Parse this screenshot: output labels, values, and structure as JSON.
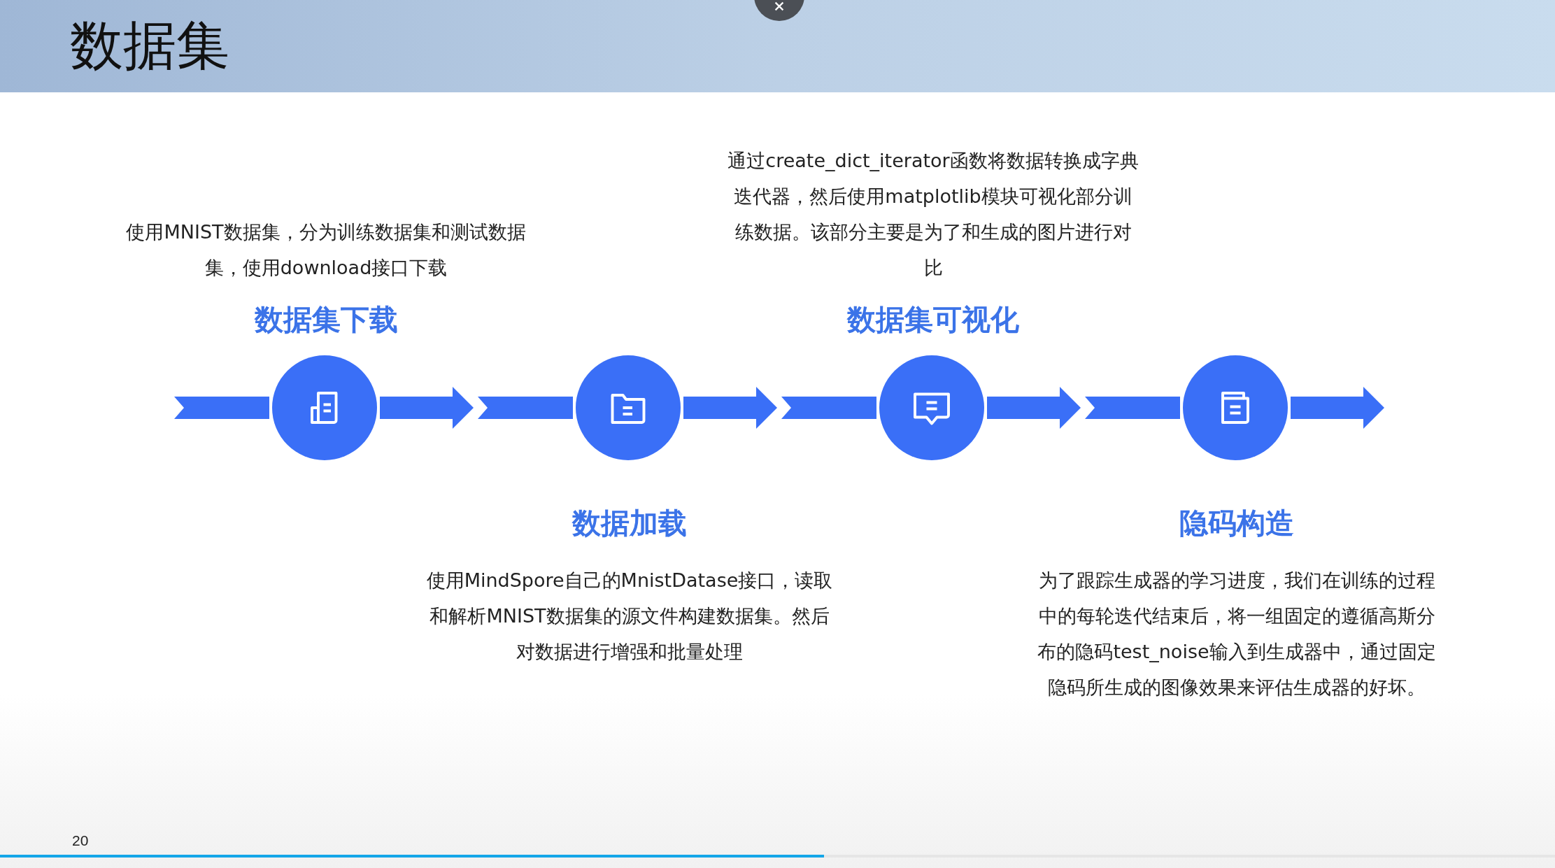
{
  "slide": {
    "title": "数据集",
    "page_number": "20"
  },
  "steps": [
    {
      "kind": "label-above",
      "title": "数据集下载",
      "description": "使用MNIST数据集，分为训练数据集和测试数据集，使用download接口下载"
    },
    {
      "kind": "label-below",
      "title": "数据加载",
      "description": "使用MindSpore自己的MnistDatase接口，读取和解析MNIST数据集的源文件构建数据集。然后对数据进行增强和批量处理"
    },
    {
      "kind": "label-above",
      "title": "数据集可视化",
      "description": "通过create_dict_iterator函数将数据转换成字典迭代器，然后使用matplotlib模块可视化部分训练数据。该部分主要是为了和生成的图片进行对比"
    },
    {
      "kind": "label-below",
      "title": "隐码构造",
      "description": "为了跟踪生成器的学习进度，我们在训练的过程中的每轮迭代结束后，将一组固定的遵循高斯分布的隐码test_noise输入到生成器中，通过固定隐码所生成的图像效果来评估生成器的好坏。"
    }
  ],
  "player": {
    "progress": {
      "level": 0.53
    }
  }
}
